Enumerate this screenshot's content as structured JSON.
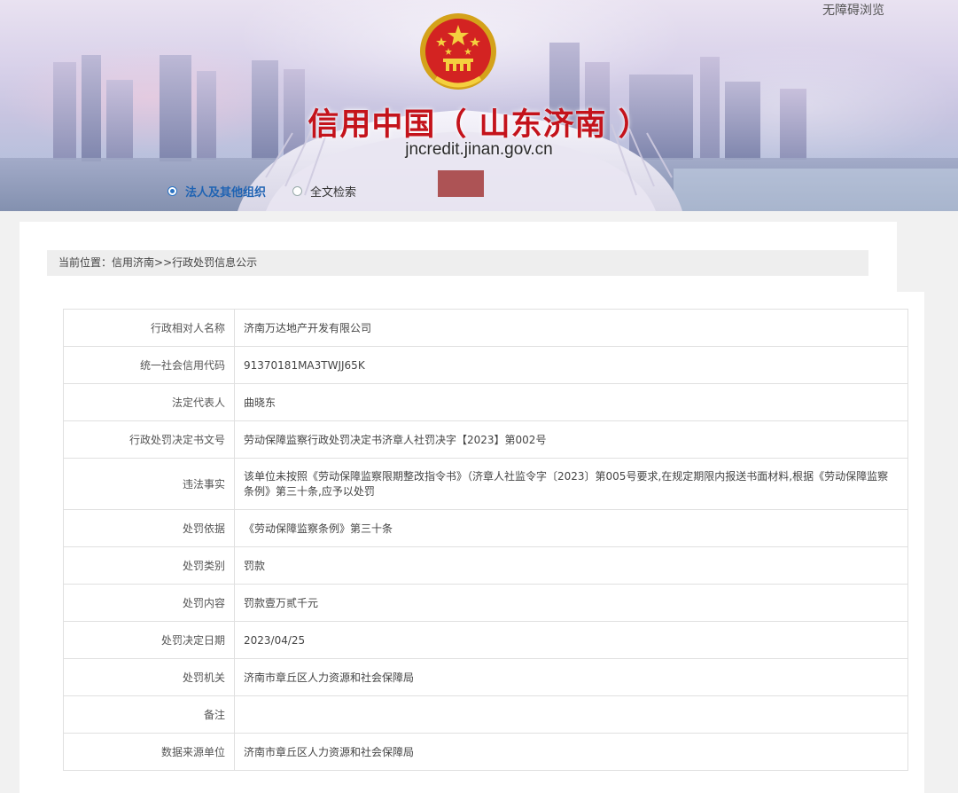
{
  "header": {
    "site_title": "信用中国（ 山东济南 ）",
    "site_url": "jncredit.jinan.gov.cn",
    "accessibility_label": "无障碍浏览",
    "search_options": [
      {
        "label": "法人及其他组织",
        "selected": true
      },
      {
        "label": "全文检索",
        "selected": false
      }
    ]
  },
  "breadcrumb": {
    "prefix": "当前位置：",
    "home": "信用济南",
    "separator": ">>",
    "current": "行政处罚信息公示"
  },
  "details": {
    "rows": [
      {
        "label": "行政相对人名称",
        "value": "济南万达地产开发有限公司"
      },
      {
        "label": "统一社会信用代码",
        "value": "91370181MA3TWJJ65K"
      },
      {
        "label": "法定代表人",
        "value": "曲晓东"
      },
      {
        "label": "行政处罚决定书文号",
        "value": "劳动保障监察行政处罚决定书济章人社罚决字【2023】第002号"
      },
      {
        "label": "违法事实",
        "value": "该单位未按照《劳动保障监察限期整改指令书》（济章人社监令字〔2023〕第005号要求,在规定期限内报送书面材料,根据《劳动保障监察条例》第三十条,应予以处罚"
      },
      {
        "label": "处罚依据",
        "value": "《劳动保障监察条例》第三十条"
      },
      {
        "label": "处罚类别",
        "value": "罚款"
      },
      {
        "label": "处罚内容",
        "value": "罚款壹万贰千元"
      },
      {
        "label": "处罚决定日期",
        "value": "2023/04/25"
      },
      {
        "label": "处罚机关",
        "value": "济南市章丘区人力资源和社会保障局"
      },
      {
        "label": "备注",
        "value": ""
      },
      {
        "label": "数据来源单位",
        "value": "济南市章丘区人力资源和社会保障局"
      }
    ]
  },
  "colors": {
    "title_red": "#c4131b",
    "accent_blue": "#1f63b3",
    "page_bg": "#f1f1f1"
  }
}
